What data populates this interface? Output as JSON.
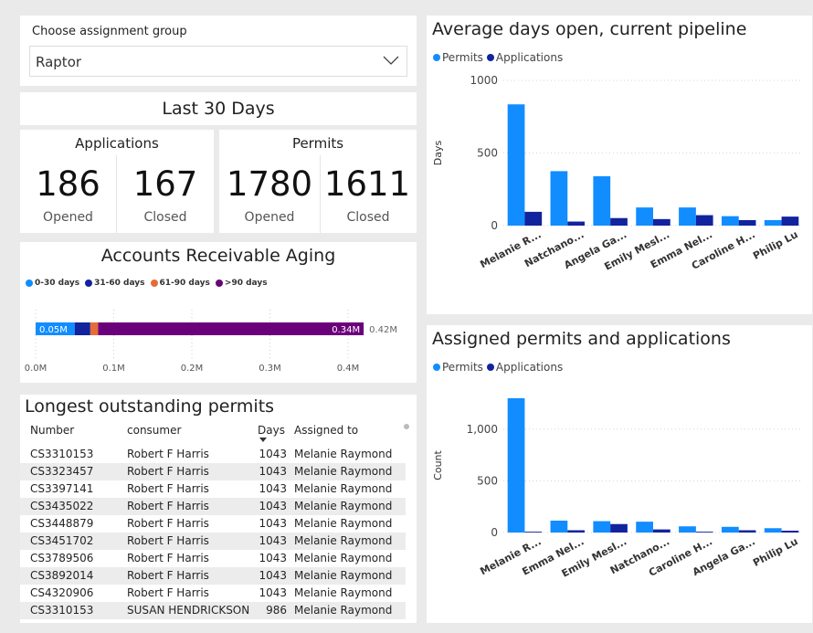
{
  "filter": {
    "label": "Choose assignment group",
    "value": "Raptor"
  },
  "period": {
    "title": "Last 30 Days"
  },
  "kpis": {
    "applications": {
      "title": "Applications",
      "opened": "186",
      "opened_label": "Opened",
      "closed": "167",
      "closed_label": "Closed"
    },
    "permits": {
      "title": "Permits",
      "opened": "1780",
      "opened_label": "Opened",
      "closed": "1611",
      "closed_label": "Closed"
    }
  },
  "colors": {
    "permits": "#118dff",
    "applications": "#12239e",
    "orange": "#e66c37",
    "purple": "#6b007b"
  },
  "ar_aging": {
    "title": "Accounts Receivable Aging",
    "legend": [
      "0-30 days",
      "31-60 days",
      "61-90 days",
      ">90 days"
    ],
    "legend_colors": [
      "#118dff",
      "#12239e",
      "#e66c37",
      "#6b007b"
    ],
    "segments_m": [
      0.05,
      0.02,
      0.01,
      0.34
    ],
    "label_first": "0.05M",
    "label_last": "0.34M",
    "total_label": "0.42M",
    "ticks": [
      "0.0M",
      "0.1M",
      "0.2M",
      "0.3M",
      "0.4M"
    ]
  },
  "table": {
    "title": "Longest outstanding permits",
    "columns": [
      "Number",
      "consumer",
      "Days",
      "Assigned to"
    ],
    "rows": [
      [
        "CS3310153",
        "Robert F Harris",
        "1043",
        "Melanie Raymond"
      ],
      [
        "CS3323457",
        "Robert F Harris",
        "1043",
        "Melanie Raymond"
      ],
      [
        "CS3397141",
        "Robert F Harris",
        "1043",
        "Melanie Raymond"
      ],
      [
        "CS3435022",
        "Robert F Harris",
        "1043",
        "Melanie Raymond"
      ],
      [
        "CS3448879",
        "Robert F Harris",
        "1043",
        "Melanie Raymond"
      ],
      [
        "CS3451702",
        "Robert F Harris",
        "1043",
        "Melanie Raymond"
      ],
      [
        "CS3789506",
        "Robert F Harris",
        "1043",
        "Melanie Raymond"
      ],
      [
        "CS3892014",
        "Robert F Harris",
        "1043",
        "Melanie Raymond"
      ],
      [
        "CS4320906",
        "Robert F Harris",
        "1043",
        "Melanie Raymond"
      ],
      [
        "CS3310153",
        "SUSAN HENDRICKSON",
        "986",
        "Melanie Raymond"
      ]
    ]
  },
  "chart_data": [
    {
      "type": "bar",
      "title": "Average days open, current pipeline",
      "ylabel": "Days",
      "yticks": [
        "0",
        "500",
        "1000"
      ],
      "ylim": [
        0,
        1000
      ],
      "categories": [
        "Melanie R...",
        "Natchano...",
        "Angela Ga...",
        "Emily Mesl...",
        "Emma Nel...",
        "Caroline H...",
        "Philip Lu"
      ],
      "series": [
        {
          "name": "Permits",
          "values": [
            835,
            375,
            340,
            125,
            125,
            65,
            38
          ]
        },
        {
          "name": "Applications",
          "values": [
            95,
            28,
            52,
            45,
            72,
            38,
            62
          ]
        }
      ]
    },
    {
      "type": "bar",
      "title": "Assigned permits and applications",
      "ylabel": "Count",
      "yticks": [
        "0",
        "500",
        "1,000"
      ],
      "ylim": [
        0,
        1300
      ],
      "categories": [
        "Melanie R...",
        "Emma Nel...",
        "Emily Mesl...",
        "Natchano...",
        "Caroline H...",
        "Angela Ga...",
        "Philip Lu"
      ],
      "series": [
        {
          "name": "Permits",
          "values": [
            1300,
            115,
            110,
            105,
            60,
            55,
            42
          ]
        },
        {
          "name": "Applications",
          "values": [
            8,
            22,
            82,
            30,
            8,
            22,
            18
          ]
        }
      ]
    }
  ]
}
